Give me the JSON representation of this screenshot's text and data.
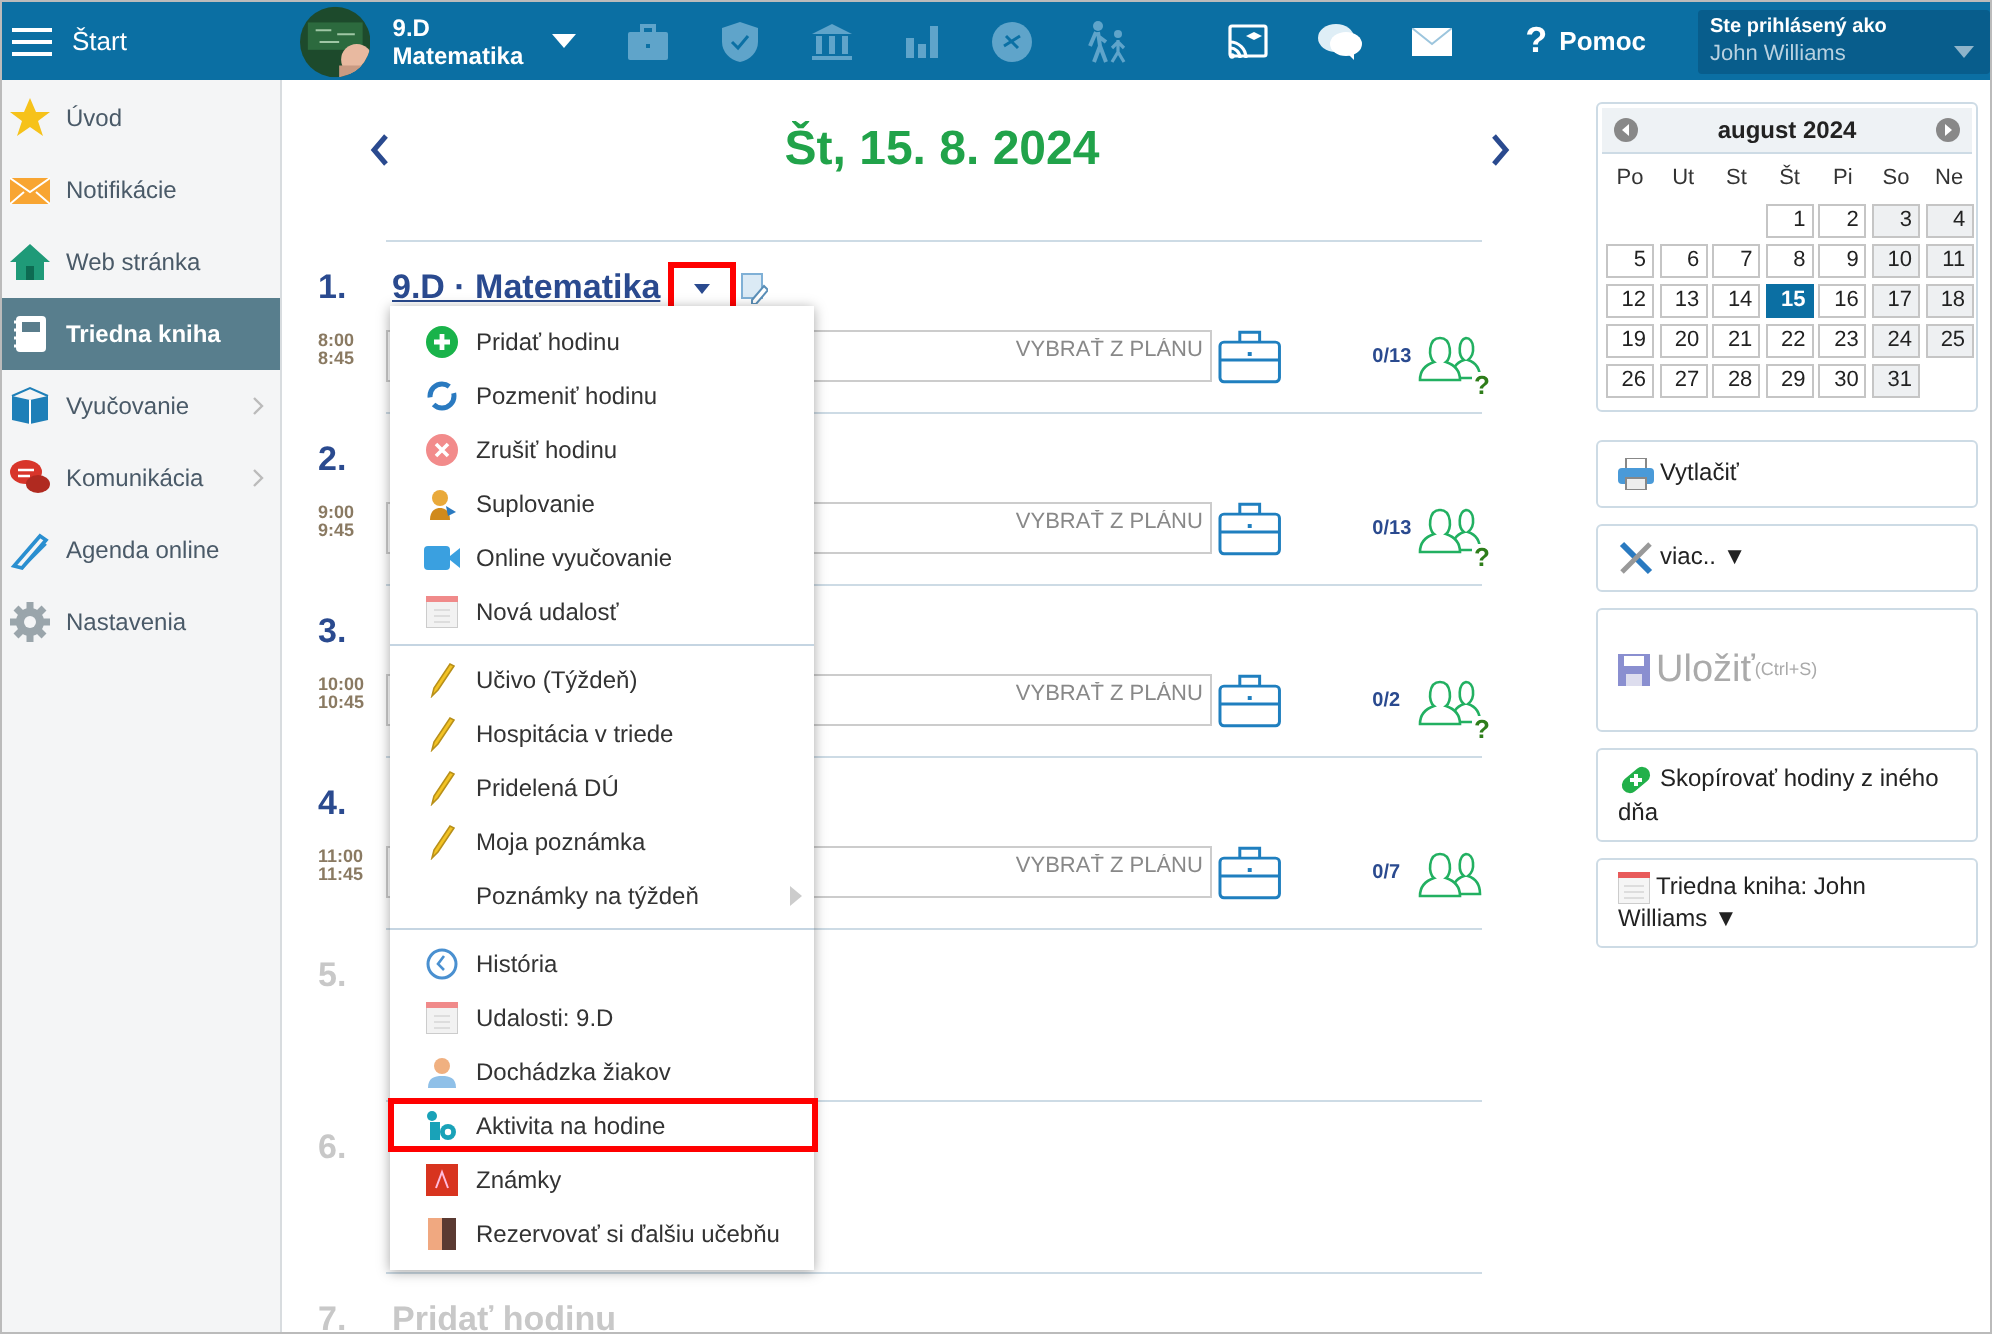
{
  "header": {
    "menu_label": "Štart",
    "class_name": "9.D",
    "subject": "Matematika",
    "help_icon": "?",
    "help_label": "Pomoc",
    "login_label": "Ste prihlásený ako",
    "user": "John Williams"
  },
  "sidebar": {
    "items": [
      {
        "label": "Úvod",
        "kind": "star",
        "selected": false,
        "has_children": false
      },
      {
        "label": "Notifikácie",
        "kind": "mail",
        "selected": false,
        "has_children": false
      },
      {
        "label": "Web stránka",
        "kind": "home",
        "selected": false,
        "has_children": false
      },
      {
        "label": "Triedna kniha",
        "kind": "book",
        "selected": true,
        "has_children": false
      },
      {
        "label": "Vyučovanie",
        "kind": "open-book",
        "selected": false,
        "has_children": true
      },
      {
        "label": "Komunikácia",
        "kind": "chat",
        "selected": false,
        "has_children": true
      },
      {
        "label": "Agenda online",
        "kind": "pen",
        "selected": false,
        "has_children": false
      },
      {
        "label": "Nastavenia",
        "kind": "gear",
        "selected": false,
        "has_children": false
      }
    ]
  },
  "day": {
    "title": "Št, 15. 8. 2024"
  },
  "lessons": [
    {
      "number": "1.",
      "active": true,
      "title": "9.D · Matematika",
      "menu_open": true,
      "start": "8:00",
      "end": "8:45",
      "placeholder": "VYBRAŤ Z PLÁNU",
      "count": "0/13",
      "status_mark": "?"
    },
    {
      "number": "2.",
      "active": true,
      "menu_open": false,
      "start": "9:00",
      "end": "9:45",
      "placeholder": "VYBRAŤ Z PLÁNU",
      "count": "0/13",
      "status_mark": "?"
    },
    {
      "number": "3.",
      "active": true,
      "menu_open": false,
      "start": "10:00",
      "end": "10:45",
      "placeholder": "VYBRAŤ Z PLÁNU",
      "count": "0/2",
      "status_mark": "?"
    },
    {
      "number": "4.",
      "active": true,
      "menu_open": false,
      "start": "11:00",
      "end": "11:45",
      "placeholder": "VYBRAŤ Z PLÁNU",
      "count": "0/7"
    },
    {
      "number": "5.",
      "active": false,
      "menu_open": false
    },
    {
      "number": "6.",
      "active": false,
      "menu_open": false
    },
    {
      "number": "7.",
      "active": false,
      "menu_open": false,
      "add_label": "Pridať hodinu"
    }
  ],
  "lesson_menu": {
    "groups": [
      [
        {
          "label": "Pridať hodinu",
          "kind": "add",
          "highlighted": false,
          "submenu": false
        },
        {
          "label": "Pozmeniť hodinu",
          "kind": "change",
          "highlighted": false,
          "submenu": false
        },
        {
          "label": "Zrušiť hodinu",
          "kind": "cancel",
          "highlighted": false,
          "submenu": false
        },
        {
          "label": "Suplovanie",
          "kind": "substitute",
          "highlighted": false,
          "submenu": false
        },
        {
          "label": "Online vyučovanie",
          "kind": "video",
          "highlighted": false,
          "submenu": false
        },
        {
          "label": "Nová udalosť",
          "kind": "calendar",
          "highlighted": false,
          "submenu": false
        }
      ],
      [
        {
          "label": "Učivo (Týždeň)",
          "kind": "pencil",
          "highlighted": false,
          "submenu": false
        },
        {
          "label": "Hospitácia v triede",
          "kind": "pencil",
          "highlighted": false,
          "submenu": false
        },
        {
          "label": "Pridelená DÚ",
          "kind": "pencil",
          "highlighted": false,
          "submenu": false
        },
        {
          "label": "Moja poznámka",
          "kind": "pencil",
          "highlighted": false,
          "submenu": false
        },
        {
          "label": "Poznámky na týždeň",
          "kind": "plain",
          "highlighted": false,
          "submenu": true
        }
      ],
      [
        {
          "label": "História",
          "kind": "clock",
          "highlighted": false,
          "submenu": false
        },
        {
          "label": "Udalosti: 9.D",
          "kind": "calendar",
          "highlighted": false,
          "submenu": false
        },
        {
          "label": "Dochádzka žiakov",
          "kind": "person",
          "highlighted": false,
          "submenu": false
        },
        {
          "label": "Aktivita na hodine",
          "kind": "activity",
          "highlighted": true,
          "submenu": false
        },
        {
          "label": "Známky",
          "kind": "grades",
          "highlighted": false,
          "submenu": false
        },
        {
          "label": "Rezervovať si ďalšiu učebňu",
          "kind": "door",
          "highlighted": false,
          "submenu": false
        }
      ]
    ]
  },
  "calendar": {
    "month": "august 2024",
    "weekdays": [
      "Po",
      "Ut",
      "St",
      "Št",
      "Pi",
      "So",
      "Ne"
    ],
    "weeks": [
      [
        {
          "kind": "blank"
        },
        {
          "kind": "blank"
        },
        {
          "kind": "blank"
        },
        {
          "day": "1",
          "weekend": false,
          "selected": false
        },
        {
          "day": "2",
          "weekend": false,
          "selected": false
        },
        {
          "day": "3",
          "weekend": true,
          "selected": false
        },
        {
          "day": "4",
          "weekend": true,
          "selected": false
        }
      ],
      [
        {
          "day": "5",
          "weekend": false,
          "selected": false
        },
        {
          "day": "6",
          "weekend": false,
          "selected": false
        },
        {
          "day": "7",
          "weekend": false,
          "selected": false
        },
        {
          "day": "8",
          "weekend": false,
          "selected": false
        },
        {
          "day": "9",
          "weekend": false,
          "selected": false
        },
        {
          "day": "10",
          "weekend": true,
          "selected": false
        },
        {
          "day": "11",
          "weekend": true,
          "selected": false
        }
      ],
      [
        {
          "day": "12",
          "weekend": false,
          "selected": false
        },
        {
          "day": "13",
          "weekend": false,
          "selected": false
        },
        {
          "day": "14",
          "weekend": false,
          "selected": false
        },
        {
          "day": "15",
          "weekend": false,
          "selected": true
        },
        {
          "day": "16",
          "weekend": false,
          "selected": false
        },
        {
          "day": "17",
          "weekend": true,
          "selected": false
        },
        {
          "day": "18",
          "weekend": true,
          "selected": false
        }
      ],
      [
        {
          "day": "19",
          "weekend": false,
          "selected": false
        },
        {
          "day": "20",
          "weekend": false,
          "selected": false
        },
        {
          "day": "21",
          "weekend": false,
          "selected": false
        },
        {
          "day": "22",
          "weekend": false,
          "selected": false
        },
        {
          "day": "23",
          "weekend": false,
          "selected": false
        },
        {
          "day": "24",
          "weekend": true,
          "selected": false
        },
        {
          "day": "25",
          "weekend": true,
          "selected": false
        }
      ],
      [
        {
          "day": "26",
          "weekend": false,
          "selected": false
        },
        {
          "day": "27",
          "weekend": false,
          "selected": false
        },
        {
          "day": "28",
          "weekend": false,
          "selected": false
        },
        {
          "day": "29",
          "weekend": false,
          "selected": false
        },
        {
          "day": "30",
          "weekend": false,
          "selected": false
        },
        {
          "day": "31",
          "weekend": true,
          "selected": false
        },
        {
          "kind": "blank"
        }
      ]
    ]
  },
  "actions": [
    {
      "label": "Vytlačiť",
      "kind": "print",
      "disabled": false
    },
    {
      "label": "viac.. ▼",
      "kind": "tools",
      "disabled": false
    },
    {
      "label": "Uložiť",
      "shortcut": "(Ctrl+S)",
      "kind": "save",
      "disabled": true
    },
    {
      "label": "Skopírovať hodiny z iného dňa",
      "kind": "copy",
      "disabled": false
    },
    {
      "label": "Triedna kniha: John Williams ▼",
      "kind": "calendar",
      "disabled": false
    }
  ]
}
